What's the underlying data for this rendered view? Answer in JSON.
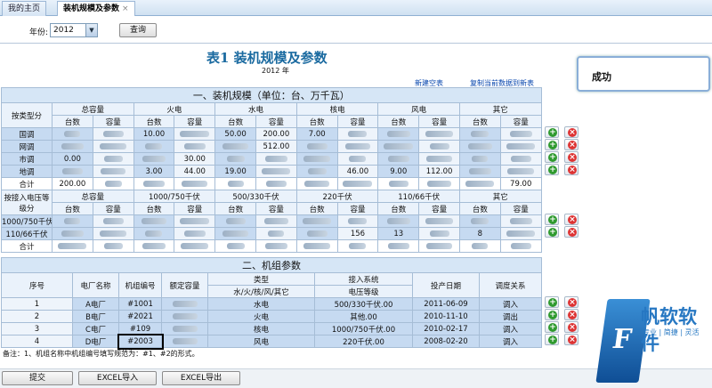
{
  "tabs": [
    "我的主页",
    "装机规模及参数"
  ],
  "filter": {
    "label": "年份:",
    "year": "2012",
    "query": "查询"
  },
  "title": "表1  装机规模及参数",
  "year_caption": "2012 年",
  "links": {
    "new": "新建空表",
    "copy": "复制当前数据到新表"
  },
  "s1": {
    "heading": "一、装机规模（单位：台、万千瓦）",
    "groups": [
      "总容量",
      "火电",
      "水电",
      "核电",
      "风电",
      "其它"
    ],
    "sub": [
      "台数",
      "容量"
    ],
    "row_head": "按类型分",
    "rows": [
      {
        "label": "国调",
        "cells": [
          "",
          "",
          "10.00",
          "",
          "50.00",
          "200.00",
          "7.00",
          "",
          "",
          "",
          "",
          ""
        ]
      },
      {
        "label": "网调",
        "cells": [
          "",
          "",
          "",
          "",
          "",
          "512.00",
          "",
          "",
          "",
          "",
          "",
          ""
        ]
      },
      {
        "label": "市调",
        "cells": [
          "0.00",
          "",
          "",
          "30.00",
          "",
          "",
          "",
          "",
          "",
          "",
          "",
          ""
        ]
      },
      {
        "label": "地调",
        "cells": [
          "",
          "",
          "3.00",
          "44.00",
          "19.00",
          "",
          "",
          "46.00",
          "9.00",
          "112.00",
          "",
          ""
        ]
      },
      {
        "label": "合计",
        "cells": [
          "200.00",
          "",
          "",
          "",
          "",
          "",
          "",
          "",
          "",
          "",
          "",
          "79.00"
        ]
      }
    ],
    "vgroups": [
      "总容量",
      "1000/750千伏",
      "500/330千伏",
      "220千伏",
      "110/66千伏",
      "其它"
    ],
    "vrow_head": "按接入电压等级分",
    "vrows": [
      {
        "label": "1000/750千伏",
        "cells": [
          "",
          "",
          "",
          "",
          "",
          "",
          "",
          "",
          "",
          "",
          "",
          ""
        ]
      },
      {
        "label": "110/66千伏",
        "cells": [
          "",
          "",
          "",
          "",
          "",
          "",
          "",
          "156",
          "13",
          "",
          "8",
          ""
        ]
      },
      {
        "label": "合计",
        "cells": [
          "",
          "",
          "",
          "",
          "",
          "",
          "",
          "",
          "",
          "",
          "",
          ""
        ]
      }
    ]
  },
  "s2": {
    "heading": "二、机组参数",
    "cols": [
      "序号",
      "电厂名称",
      "机组编号",
      "额定容量",
      "类型",
      "接入系统",
      "投产日期",
      "调度关系"
    ],
    "type_sub": "水/火/核/风/其它",
    "sys_sub": "电压等级",
    "rows": [
      {
        "no": "1",
        "plant": "A电厂",
        "unit": "#1001",
        "cap": "",
        "type": "水电",
        "volt": "500/330千伏.00",
        "date": "2011-06-09",
        "rel": "调入"
      },
      {
        "no": "2",
        "plant": "B电厂",
        "unit": "#2021",
        "cap": "",
        "type": "火电",
        "volt": "其他.00",
        "date": "2010-11-10",
        "rel": "调出"
      },
      {
        "no": "3",
        "plant": "C电厂",
        "unit": "#109",
        "cap": "",
        "type": "核电",
        "volt": "1000/750千伏.00",
        "date": "2010-02-17",
        "rel": "调入"
      },
      {
        "no": "4",
        "plant": "D电厂",
        "unit": "#2003",
        "cap": "",
        "type": "风电",
        "volt": "220千伏.00",
        "date": "2008-02-20",
        "rel": "调入"
      }
    ]
  },
  "note": "备注：1、机组名称中机组编号填写规范为：#1、#2的形式。",
  "bottom": {
    "submit": "提交",
    "import": "EXCEL导入",
    "export": "EXCEL导出"
  },
  "toast": "成功",
  "watermark": {
    "brand": "帆软软件",
    "slogan": "专业 | 简捷 | 灵活"
  }
}
